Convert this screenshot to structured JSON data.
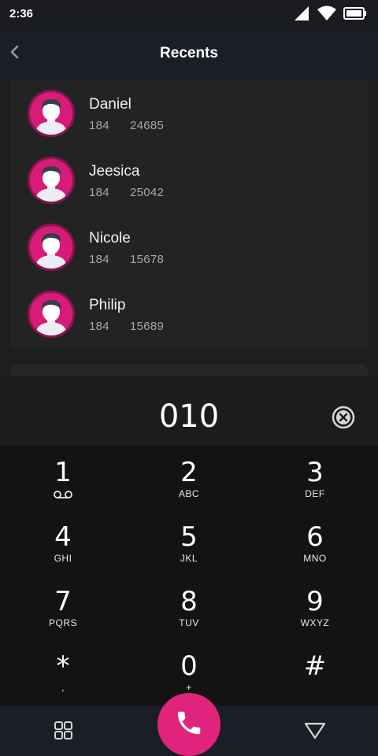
{
  "status_bar": {
    "time": "2:36"
  },
  "app_bar": {
    "title": "Recents"
  },
  "contacts": [
    {
      "name": "Daniel",
      "number_prefix": "184",
      "number_suffix": "24685"
    },
    {
      "name": "Jeesica",
      "number_prefix": "184",
      "number_suffix": "25042"
    },
    {
      "name": "Nicole",
      "number_prefix": "184",
      "number_suffix": "15678"
    },
    {
      "name": "Philip",
      "number_prefix": "184",
      "number_suffix": "15689"
    }
  ],
  "dialer": {
    "number": "010"
  },
  "keypad": [
    {
      "digit": "1",
      "letters": ""
    },
    {
      "digit": "2",
      "letters": "ABC"
    },
    {
      "digit": "3",
      "letters": "DEF"
    },
    {
      "digit": "4",
      "letters": "GHI"
    },
    {
      "digit": "5",
      "letters": "JKL"
    },
    {
      "digit": "6",
      "letters": "MNO"
    },
    {
      "digit": "7",
      "letters": "PQRS"
    },
    {
      "digit": "8",
      "letters": "TUV"
    },
    {
      "digit": "9",
      "letters": "WXYZ"
    },
    {
      "digit": "*",
      "letters": ","
    },
    {
      "digit": "0",
      "letters": "+"
    },
    {
      "digit": "#",
      "letters": ""
    }
  ],
  "icons": {
    "back": "chevron-left-icon",
    "clear": "clear-circle-icon",
    "grid": "grid-icon",
    "call": "phone-icon",
    "hide": "triangle-down-icon",
    "voicemail": "voicemail-icon"
  },
  "colors": {
    "accent": "#e0247b",
    "avatar_bg": "#d81b79",
    "background": "#1a1c22"
  }
}
